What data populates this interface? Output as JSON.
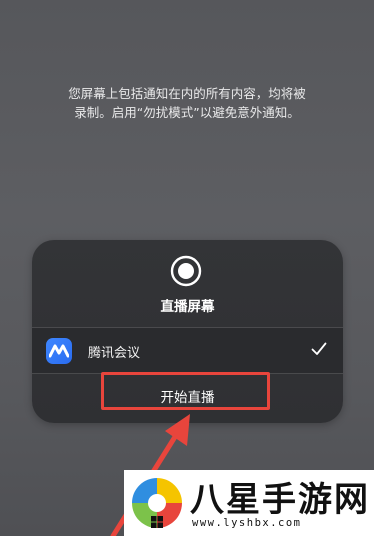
{
  "notice": {
    "line1": "您屏幕上包括通知在内的所有内容，均将被",
    "line2": "录制。启用“勿扰模式”以避免意外通知。"
  },
  "panel": {
    "icon": "record-icon",
    "title": "直播屏幕",
    "app": {
      "name": "腾讯会议",
      "icon": "tencent-meeting-icon",
      "selected": true,
      "check_icon": "checkmark-icon"
    },
    "start_button_label": "开始直播"
  },
  "annotation": {
    "highlight_color": "#e8453c",
    "arrow_color": "#e8453c"
  },
  "watermark": {
    "title": "八星手游网",
    "url": "www.lyshbx.com"
  }
}
